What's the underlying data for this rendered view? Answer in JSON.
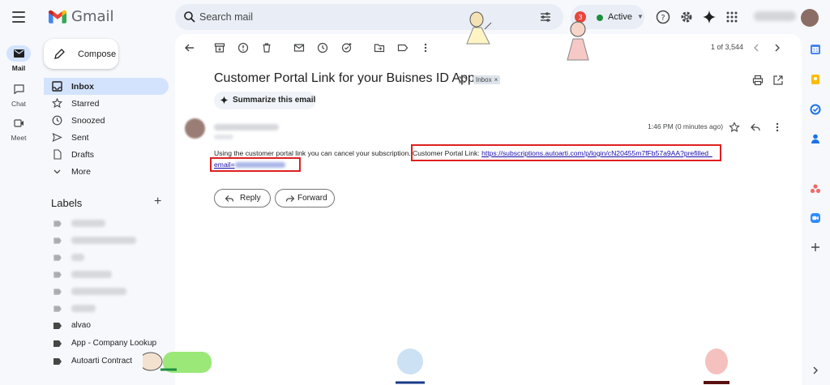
{
  "header": {
    "app_name": "Gmail",
    "search_placeholder": "Search mail",
    "status_label": "Active"
  },
  "rail": {
    "items": [
      {
        "label": "Mail",
        "icon": "mail-icon"
      },
      {
        "label": "Chat",
        "icon": "chat-icon"
      },
      {
        "label": "Meet",
        "icon": "meet-icon"
      }
    ]
  },
  "sidebar": {
    "compose_label": "Compose",
    "nav": [
      {
        "label": "Inbox",
        "icon": "inbox-icon",
        "active": true
      },
      {
        "label": "Starred",
        "icon": "star-icon"
      },
      {
        "label": "Snoozed",
        "icon": "clock-icon"
      },
      {
        "label": "Sent",
        "icon": "send-icon"
      },
      {
        "label": "Drafts",
        "icon": "draft-icon"
      },
      {
        "label": "More",
        "icon": "chevron-down-icon"
      }
    ],
    "labels_heading": "Labels",
    "labels": [
      {
        "label": "alvao"
      },
      {
        "label": "App - Company Lookup"
      },
      {
        "label": "Autoarti Contract"
      }
    ]
  },
  "toolbar": {
    "pager": "1 of 3,544"
  },
  "email": {
    "subject": "Customer Portal Link for your Buisnes ID App",
    "inbox_chip": "Inbox",
    "inbox_chip_close": "×",
    "summarize_label": "Summarize this email",
    "time": "1:46 PM (0 minutes ago)",
    "body_prefix": "Using the customer portal link you can cancel your subscription.",
    "body_link_label": "Customer Portal Link:",
    "portal_link_line1": "https://subscriptions.autoarti.com/p/login/cN20455m7fFb57a9AA?prefilled_",
    "portal_link_line2": "email=",
    "reply_label": "Reply",
    "forward_label": "Forward"
  },
  "colors": {
    "accent": "#d3e3fd",
    "link": "#1a0dab",
    "highlight": "#e02020",
    "status_green": "#1e8e3e"
  }
}
